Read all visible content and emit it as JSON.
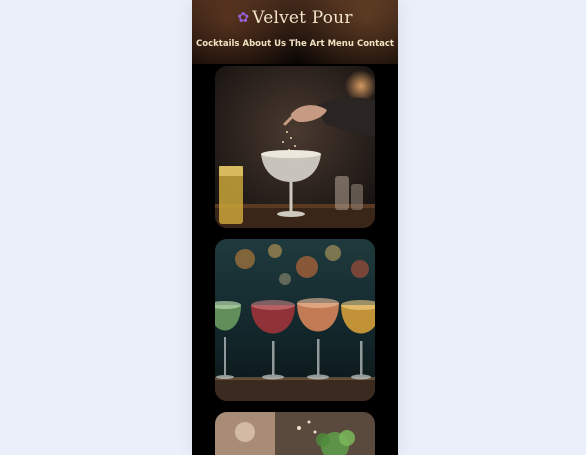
{
  "site": {
    "brand_name": "Velvet Pour",
    "brand_icon": "grapes-icon"
  },
  "nav": {
    "items": [
      {
        "label": "Cocktails"
      },
      {
        "label": "About Us"
      },
      {
        "label": "The Art"
      },
      {
        "label": "Menu"
      },
      {
        "label": "Contact"
      }
    ]
  },
  "gallery": {
    "images": [
      {
        "subject": "bartender sprinkling garnish into coupe glass",
        "icon": "cocktail-photo"
      },
      {
        "subject": "row of colorful gin tonic glasses on bar",
        "icon": "cocktail-photo"
      },
      {
        "subject": "cocktail with mint garnish",
        "icon": "cocktail-photo"
      }
    ]
  },
  "colors": {
    "page_background": "#eaeff9",
    "device_background": "#000000",
    "nav_text": "#f0e2c2",
    "brand_text": "#f3e4c8"
  }
}
